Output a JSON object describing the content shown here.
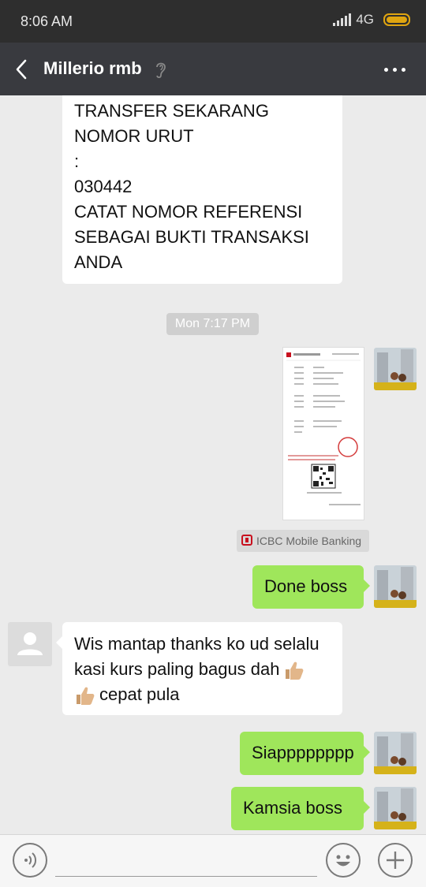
{
  "status_bar": {
    "time": "8:06 AM",
    "network": "4G"
  },
  "header": {
    "title": "Millerio  rmb"
  },
  "messages": {
    "m1": {
      "lines": [
        "TRANSFER SEKARANG",
        "NOMOR URUT",
        ":",
        "030442",
        "CATAT NOMOR REFERENSI",
        "SEBAGAI BUKTI TRANSAKSI",
        "ANDA"
      ]
    },
    "timestamp": "Mon 7:17 PM",
    "source_app": "ICBC Mobile Banking",
    "m2": "Done boss",
    "m3": {
      "line1": "Wis mantap thanks ko ud selalu",
      "line2_a": "kasi kurs paling bagus dah",
      "line3_b": "cepat pula"
    },
    "m4": "Siapppppppp",
    "m5": "Kamsia boss"
  },
  "colors": {
    "outgoing_bubble": "#9fe65b",
    "incoming_bubble": "#ffffff",
    "title_bar": "#393a3f",
    "status_bar": "#2e2e2e",
    "chat_bg": "#ebebeb"
  },
  "icons": [
    "back-arrow-icon",
    "hearing-icon",
    "more-icon",
    "voice-icon",
    "emoji-icon",
    "plus-icon",
    "thumbs-up-emoji"
  ]
}
